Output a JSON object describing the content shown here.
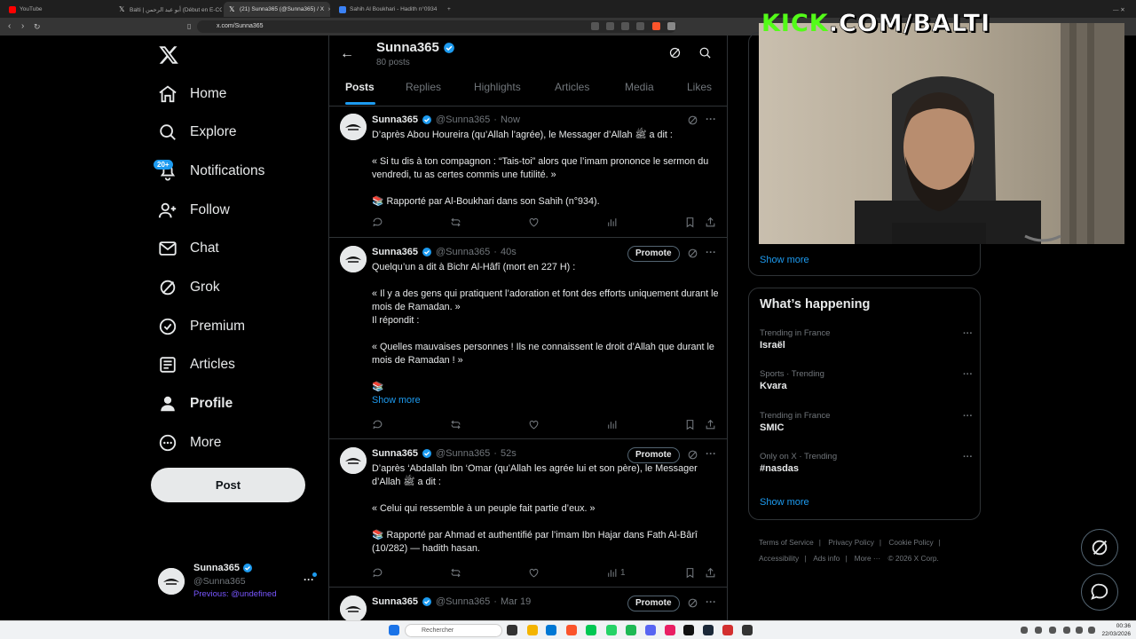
{
  "browser": {
    "tabs": [
      {
        "title": "YouTube",
        "color": "#ff0000"
      },
      {
        "title": "Balti | أبو عبد الرحمن (Début en E-COM)",
        "color": "#ffffff"
      },
      {
        "title": "(21) Sunna365 (@Sunna365) / X",
        "color": "#ffffff"
      },
      {
        "title": "Sahih Al Boukhari - Hadith n°0934",
        "color": "#3b82f6"
      }
    ],
    "url": "x.com/Sunna365"
  },
  "sidebar": {
    "logo": "X",
    "items": [
      {
        "label": "Home",
        "icon": "home-icon"
      },
      {
        "label": "Explore",
        "icon": "search-icon"
      },
      {
        "label": "Notifications",
        "icon": "bell-icon"
      },
      {
        "label": "Follow",
        "icon": "follow-icon"
      },
      {
        "label": "Chat",
        "icon": "mail-icon"
      },
      {
        "label": "Grok",
        "icon": "grok-icon"
      },
      {
        "label": "Premium",
        "icon": "premium-icon"
      },
      {
        "label": "Articles",
        "icon": "articles-icon"
      },
      {
        "label": "Profile",
        "icon": "profile-icon"
      },
      {
        "label": "More",
        "icon": "more-icon"
      }
    ],
    "notif_badge": "20+",
    "post_label": "Post",
    "account": {
      "name": "Sunna365",
      "handle": "@Sunna365",
      "previous": "Previous: @undefined"
    }
  },
  "profile_header": {
    "name": "Sunna365",
    "posts_count": "80 posts"
  },
  "profile_tabs": [
    "Posts",
    "Replies",
    "Highlights",
    "Articles",
    "Media",
    "Likes"
  ],
  "tweets": [
    {
      "name": "Sunna365",
      "handle": "@Sunna365",
      "time": "Now",
      "promote": "",
      "lines": [
        "D’après Abou Houreira (qu’Allah l’agrée), le Messager d’Allah ﷺ a dit :",
        "",
        "« Si tu dis à ton compagnon : “Tais-toi” alors que l’imam prononce le sermon du vendredi, tu as certes commis une futilité. »",
        "",
        "📚 Rapporté par Al-Boukhari dans son Sahih (n°934)."
      ],
      "show_more": "",
      "views": ""
    },
    {
      "name": "Sunna365",
      "handle": "@Sunna365",
      "time": "40s",
      "promote": "Promote",
      "lines": [
        "Quelqu’un a dit à Bichr Al-Hâfî (mort en 227 H) :",
        "",
        "« Il y a des gens qui pratiquent l’adoration et font des efforts uniquement durant le mois de Ramadan. »",
        "Il répondit :",
        "",
        "« Quelles mauvaises personnes ! Ils ne connaissent le droit d’Allah que durant le mois de Ramadan ! »",
        "",
        "📚"
      ],
      "show_more": "Show more",
      "views": ""
    },
    {
      "name": "Sunna365",
      "handle": "@Sunna365",
      "time": "52s",
      "promote": "Promote",
      "lines": [
        "D’après ‘Abdallah Ibn ‘Omar (qu’Allah les agrée lui et son père), le Messager d’Allah ﷺ a dit :",
        "",
        "« Celui qui ressemble à un peuple fait partie d’eux. »",
        "",
        "📚 Rapporté par Ahmad et authentifié par l’imam Ibn Hajar dans Fath Al-Bârî (10/282) — hadith hasan."
      ],
      "show_more": "",
      "views": "1"
    },
    {
      "name": "Sunna365",
      "handle": "@Sunna365",
      "time": "Mar 19",
      "promote": "Promote",
      "lines": [],
      "show_more": "",
      "views": ""
    }
  ],
  "right": {
    "top_show_more": "Show more",
    "happening_title": "What’s happening",
    "trends": [
      {
        "category": "Trending in France",
        "name": "Israël"
      },
      {
        "category": "Sports · Trending",
        "name": "Kvara"
      },
      {
        "category": "Trending in France",
        "name": "SMIC"
      },
      {
        "category": "Only on X · Trending",
        "name": "#nasdas"
      }
    ],
    "happening_show_more": "Show more",
    "footer": [
      "Terms of Service",
      "Privacy Policy",
      "Cookie Policy",
      "Accessibility",
      "Ads info",
      "More ···",
      "© 2026 X Corp."
    ]
  },
  "overlay": {
    "kick_part1": "KICK",
    "kick_part2": ".COM/BALTI"
  },
  "taskbar": {
    "search_placeholder": "Rechercher",
    "time": "00:36",
    "date": "22/03/2026"
  },
  "colors": {
    "accent": "#1d9bf0",
    "kick_green": "#53fc18",
    "background": "#000000",
    "muted": "#71767b"
  }
}
